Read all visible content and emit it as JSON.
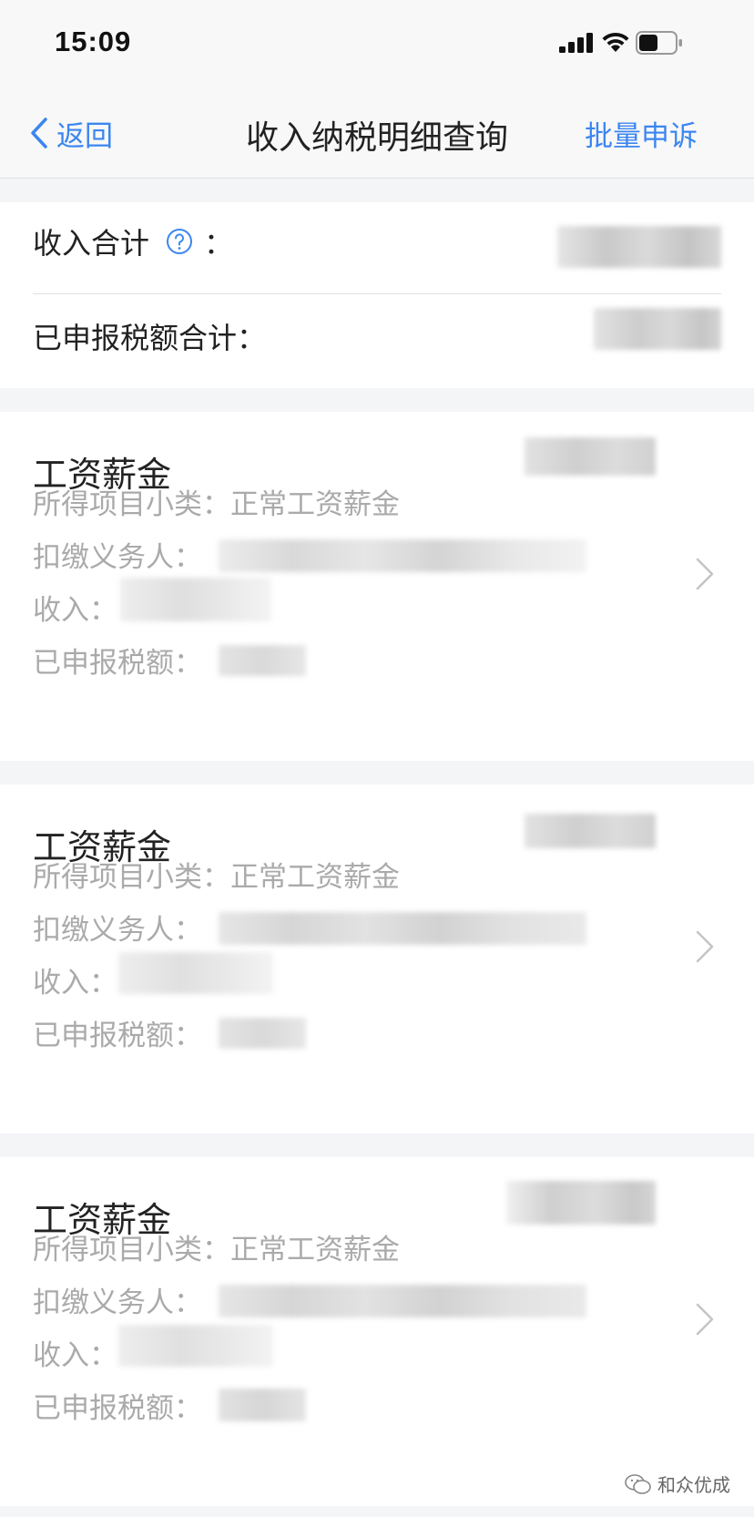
{
  "status_bar": {
    "time": "15:09"
  },
  "nav": {
    "back_label": "返回",
    "title": "收入纳税明细查询",
    "action_label": "批量申诉",
    "accent_color": "#3b86f0"
  },
  "summary": {
    "income_total_label": "收入合计",
    "income_total_colon": "：",
    "tax_total_label": "已申报税额合计："
  },
  "records": [
    {
      "title": "工资薪金",
      "subcategory_label": "所得项目小类：",
      "subcategory_value": "正常工资薪金",
      "withholder_label": "扣缴义务人：",
      "income_label": "收入：",
      "tax_label": "已申报税额："
    },
    {
      "title": "工资薪金",
      "subcategory_label": "所得项目小类：",
      "subcategory_value": "正常工资薪金",
      "withholder_label": "扣缴义务人：",
      "income_label": "收入：",
      "tax_label": "已申报税额："
    },
    {
      "title": "工资薪金",
      "subcategory_label": "所得项目小类：",
      "subcategory_value": "正常工资薪金",
      "withholder_label": "扣缴义务人：",
      "income_label": "收入：",
      "tax_label": "已申报税额："
    }
  ],
  "watermark": {
    "text": "和众优成"
  }
}
